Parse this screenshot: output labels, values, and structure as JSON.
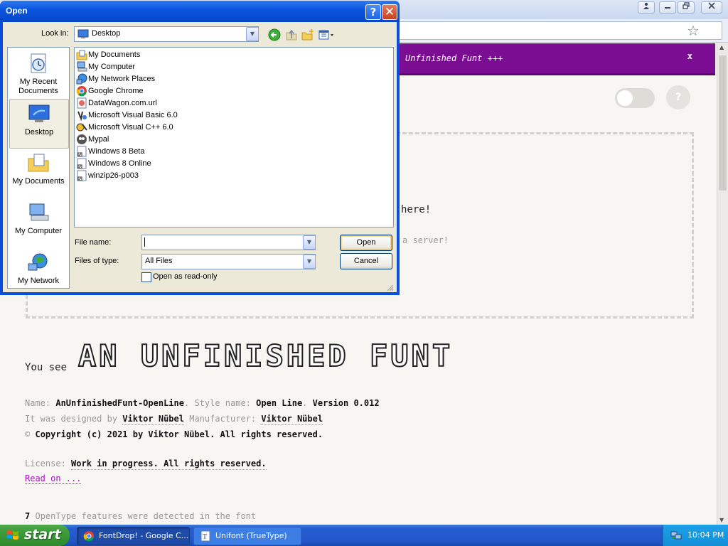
{
  "browser": {
    "controls": [
      "user",
      "minimize",
      "restore",
      "close"
    ],
    "page": {
      "banner_title": "Unfinished Funt +++",
      "banner_close": "x",
      "help_label": "?",
      "dropzone_text1": "here!",
      "dropzone_text2": "a server!",
      "you_see": "You see",
      "sample_text": "An unfinished funt",
      "meta": {
        "name_label": "Name:",
        "name_value": "AnUnfinishedFunt-OpenLine",
        "style_label": "Style name:",
        "style_value": "Open Line",
        "version_value": "Version 0.012",
        "designed_label": "It was designed by",
        "designer": "Viktor Nübel",
        "manufacturer_label": "Manufacturer:",
        "manufacturer": "Viktor Nübel",
        "copyright_symbol": "©",
        "copyright": "Copyright (c) 2021 by Viktor Nübel. All rights reserved.",
        "license_label": "License:",
        "license_value": "Work in progress. All rights reserved.",
        "read_on": "Read on ...",
        "features_count": "7",
        "features_text": "OpenType features were detected in the font"
      }
    }
  },
  "dialog": {
    "title": "Open",
    "help_btn": "?",
    "close_btn": "✕",
    "look_in_label": "Look in:",
    "look_in_value": "Desktop",
    "places": [
      {
        "label": "My Recent Documents",
        "icon": "recent-documents-icon"
      },
      {
        "label": "Desktop",
        "icon": "desktop-icon",
        "selected": true
      },
      {
        "label": "My Documents",
        "icon": "my-documents-icon"
      },
      {
        "label": "My Computer",
        "icon": "my-computer-icon"
      },
      {
        "label": "My Network",
        "icon": "my-network-icon"
      }
    ],
    "files": [
      {
        "name": "My Documents",
        "icon": "folder-docs-icon"
      },
      {
        "name": "My Computer",
        "icon": "computer-icon"
      },
      {
        "name": "My Network Places",
        "icon": "network-places-icon"
      },
      {
        "name": "Google Chrome",
        "icon": "chrome-icon"
      },
      {
        "name": "DataWagon.com.url",
        "icon": "url-icon"
      },
      {
        "name": "Microsoft Visual Basic 6.0",
        "icon": "vb-icon"
      },
      {
        "name": "Microsoft Visual C++ 6.0",
        "icon": "vc-icon"
      },
      {
        "name": "Mypal",
        "icon": "mypal-icon"
      },
      {
        "name": "Windows 8 Beta",
        "icon": "shortcut-icon"
      },
      {
        "name": "Windows 8 Online",
        "icon": "shortcut-icon"
      },
      {
        "name": "winzip26-p003",
        "icon": "shortcut-icon"
      }
    ],
    "file_name_label": "File name:",
    "file_name_value": "",
    "files_of_type_label": "Files of type:",
    "files_of_type_value": "All Files",
    "open_btn": "Open",
    "cancel_btn": "Cancel",
    "readonly_label": "Open as read-only"
  },
  "taskbar": {
    "start": "start",
    "tasks": [
      {
        "label": "FontDrop! - Google C...",
        "active": true
      },
      {
        "label": "Unifont (TrueType)",
        "active": false
      }
    ],
    "clock": "10:04 PM"
  },
  "colors": {
    "banner": "#7a0d92",
    "xp_title": "#0a55e0",
    "taskbar": "#245cd0",
    "start": "#3b9a39"
  }
}
